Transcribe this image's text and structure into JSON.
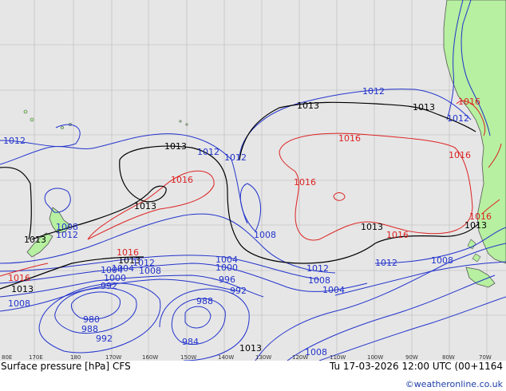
{
  "map": {
    "title": "Surface pressure [hPa] CFS",
    "valid_time": "Tu 17-03-2026 12:00 UTC (00+1164",
    "credit": "©weatheronline.co.uk",
    "longitude_labels": [
      "80E",
      "170E",
      "180",
      "170W",
      "160W",
      "150W",
      "140W",
      "130W",
      "120W",
      "110W",
      "100W",
      "90W",
      "80W",
      "70W"
    ],
    "colors": {
      "ocean": "#e6e6e6",
      "land": "#b6f0a0",
      "low_isobar": "#2233cc",
      "high_isobar": "#dd2222",
      "mid_isobar": "#000000"
    },
    "isobar_labels": [
      {
        "value": "1012",
        "color": "blue"
      },
      {
        "value": "1013",
        "color": "black"
      },
      {
        "value": "1013",
        "color": "black"
      },
      {
        "value": "1016",
        "color": "red"
      },
      {
        "value": "1012",
        "color": "blue"
      },
      {
        "value": "1012",
        "color": "blue"
      },
      {
        "value": "1013",
        "color": "black"
      },
      {
        "value": "1012",
        "color": "blue"
      },
      {
        "value": "1016",
        "color": "red"
      },
      {
        "value": "1012",
        "color": "blue"
      },
      {
        "value": "1013",
        "color": "black"
      },
      {
        "value": "1016",
        "color": "red"
      },
      {
        "value": "1016",
        "color": "red"
      },
      {
        "value": "1016",
        "color": "red"
      },
      {
        "value": "1013",
        "color": "black"
      },
      {
        "value": "1008",
        "color": "blue"
      },
      {
        "value": "1012",
        "color": "blue"
      },
      {
        "value": "1013",
        "color": "black"
      },
      {
        "value": "1016",
        "color": "red"
      },
      {
        "value": "1013",
        "color": "black"
      },
      {
        "value": "1016",
        "color": "red"
      },
      {
        "value": "1013",
        "color": "black"
      },
      {
        "value": "1012",
        "color": "blue"
      },
      {
        "value": "1008",
        "color": "blue"
      },
      {
        "value": "1004",
        "color": "blue"
      },
      {
        "value": "1000",
        "color": "blue"
      },
      {
        "value": "996",
        "color": "blue"
      },
      {
        "value": "992",
        "color": "blue"
      },
      {
        "value": "988",
        "color": "blue"
      },
      {
        "value": "984",
        "color": "blue"
      },
      {
        "value": "1008",
        "color": "blue"
      },
      {
        "value": "1004",
        "color": "blue"
      },
      {
        "value": "1012",
        "color": "blue"
      },
      {
        "value": "1008",
        "color": "blue"
      },
      {
        "value": "1008",
        "color": "blue"
      },
      {
        "value": "1016",
        "color": "red"
      },
      {
        "value": "1016",
        "color": "red"
      },
      {
        "value": "1013",
        "color": "black"
      },
      {
        "value": "1008",
        "color": "blue"
      },
      {
        "value": "1004",
        "color": "blue"
      },
      {
        "value": "1000",
        "color": "blue"
      },
      {
        "value": "992",
        "color": "blue"
      },
      {
        "value": "980",
        "color": "blue"
      },
      {
        "value": "988",
        "color": "blue"
      },
      {
        "value": "992",
        "color": "blue"
      },
      {
        "value": "1008",
        "color": "blue"
      },
      {
        "value": "1004",
        "color": "blue"
      },
      {
        "value": "1012",
        "color": "blue"
      },
      {
        "value": "1013",
        "color": "black"
      }
    ]
  }
}
